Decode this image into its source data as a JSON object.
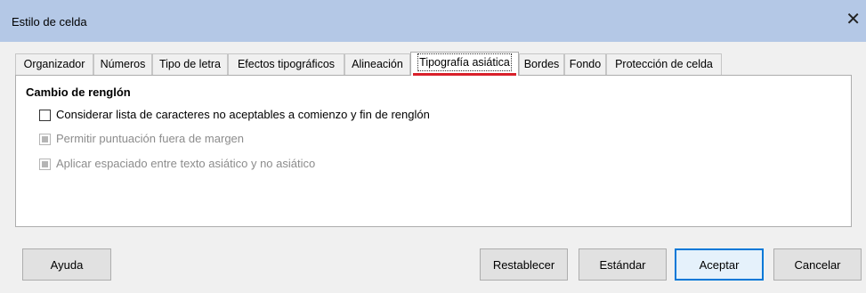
{
  "window": {
    "title": "Estilo de celda",
    "close_glyph": "✕"
  },
  "tabs": [
    {
      "label": "Organizador",
      "active": false
    },
    {
      "label": "Números",
      "active": false
    },
    {
      "label": "Tipo de letra",
      "active": false
    },
    {
      "label": "Efectos tipográficos",
      "active": false
    },
    {
      "label": "Alineación",
      "active": false
    },
    {
      "label": "Tipografía asiática",
      "active": true
    },
    {
      "label": "Bordes",
      "active": false
    },
    {
      "label": "Fondo",
      "active": false
    },
    {
      "label": "Protección de celda",
      "active": false
    }
  ],
  "panel": {
    "group_title": "Cambio de renglón",
    "options": [
      {
        "label": "Considerar lista de caracteres no aceptables a comienzo y fin de renglón",
        "checked": false,
        "enabled": true
      },
      {
        "label": "Permitir puntuación fuera de margen",
        "checked": false,
        "enabled": false
      },
      {
        "label": "Aplicar espaciado entre texto asiático y no asiático",
        "checked": false,
        "enabled": false
      }
    ]
  },
  "buttons": {
    "help": "Ayuda",
    "reset": "Restablecer",
    "standard": "Estándar",
    "ok": "Aceptar",
    "cancel": "Cancelar"
  },
  "colors": {
    "titlebar": "#b4c8e6",
    "active_tab_underline": "#d9202a",
    "default_button_border": "#0078d7"
  }
}
